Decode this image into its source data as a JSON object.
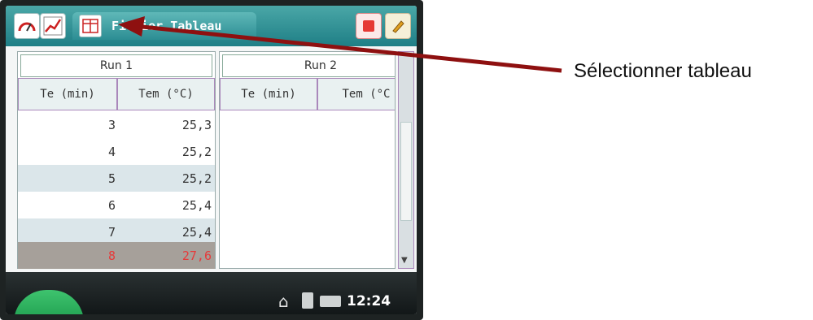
{
  "toolbar": {
    "tabs": [
      {
        "icon": "meter-icon"
      },
      {
        "icon": "graph-icon"
      },
      {
        "icon": "table-icon",
        "label": "Fichier Tableau",
        "active": true
      }
    ],
    "right_icons": [
      "record-icon",
      "notes-icon"
    ]
  },
  "table": {
    "runs": [
      {
        "label": "Run 1",
        "columns": [
          "Te (min)",
          "Tem (°C)"
        ],
        "rows": [
          {
            "c1": "3",
            "c2": "25,3"
          },
          {
            "c1": "4",
            "c2": "25,2"
          },
          {
            "c1": "5",
            "c2": "25,2"
          },
          {
            "c1": "6",
            "c2": "25,4"
          },
          {
            "c1": "7",
            "c2": "25,4"
          },
          {
            "c1": "8",
            "c2": "27,6",
            "selected": true
          }
        ]
      },
      {
        "label": "Run 2",
        "columns": [
          "Te (min)",
          "Tem (°C"
        ],
        "rows": []
      }
    ]
  },
  "statusbar": {
    "icons": [
      "home-icon",
      "calculator-icon",
      "keyboard-icon"
    ],
    "time": "12:24"
  },
  "annotation": {
    "text": "Sélectionner tableau"
  },
  "colors": {
    "accent": "#2c8d93",
    "selection_text": "#e63a3a",
    "arrow": "#8e1010"
  }
}
